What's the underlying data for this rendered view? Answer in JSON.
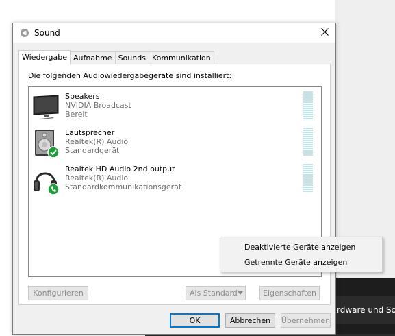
{
  "background": {
    "taskbar_text": "rdware und Sound"
  },
  "dialog": {
    "title": "Sound",
    "close_label": "✕",
    "tabs": [
      {
        "label": "Wiedergabe",
        "active": true
      },
      {
        "label": "Aufnahme",
        "active": false
      },
      {
        "label": "Sounds",
        "active": false
      },
      {
        "label": "Kommunikation",
        "active": false
      }
    ],
    "heading": "Die folgenden Audiowiedergabegeräte sind installiert:",
    "devices": [
      {
        "name": "Speakers",
        "driver": "NVIDIA Broadcast",
        "status": "Bereit",
        "icon": "monitor-icon"
      },
      {
        "name": "Lautsprecher",
        "driver": "Realtek(R) Audio",
        "status": "Standardgerät",
        "icon": "speaker-icon"
      },
      {
        "name": "Realtek HD Audio 2nd output",
        "driver": "Realtek(R) Audio",
        "status": "Standardkommunikationsgerät",
        "icon": "headphones-icon"
      }
    ],
    "buttons": {
      "configure": "Konfigurieren",
      "set_default": "Als Standard",
      "properties": "Eigenschaften",
      "ok": "OK",
      "cancel": "Abbrechen",
      "apply": "Übernehmen"
    }
  },
  "context_menu": {
    "items": [
      "Deaktivierte Geräte anzeigen",
      "Getrennte Geräte anzeigen"
    ]
  },
  "colors": {
    "accent": "#0078d7",
    "check_green": "#1e9e3a",
    "meter": "#bfe4ea"
  }
}
